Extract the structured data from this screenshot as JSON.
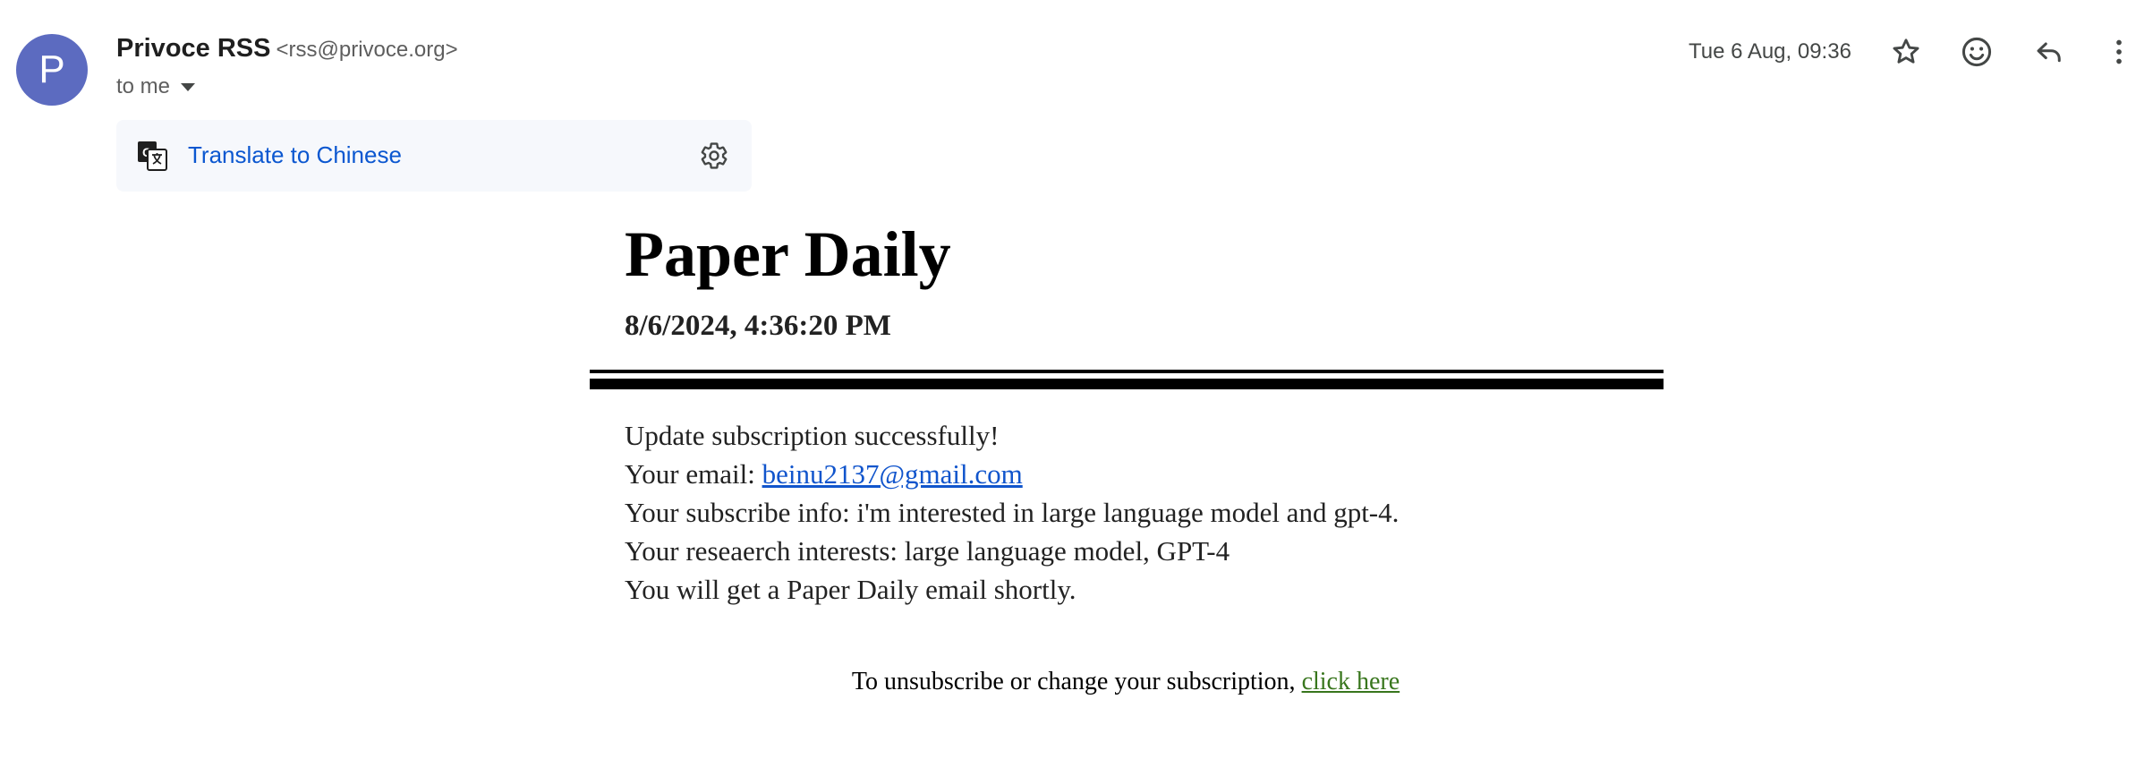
{
  "header": {
    "avatar_letter": "P",
    "avatar_color": "#5c6bc0",
    "sender_name": "Privoce RSS",
    "sender_email": "<rss@privoce.org>",
    "recipient_label": "to me",
    "date": "Tue 6 Aug, 09:36",
    "icons": [
      "star-icon",
      "emoji-icon",
      "reply-icon",
      "more-vert-icon"
    ]
  },
  "translate": {
    "label": "Translate to Chinese",
    "link_color": "#0b57d0"
  },
  "email": {
    "title": "Paper Daily",
    "timestamp": "8/6/2024, 4:36:20 PM",
    "lines": {
      "line1": "Update subscription successfully!",
      "email_prefix": "Your email: ",
      "email_value": "beinu2137@gmail.com",
      "line3": "Your subscribe info: i'm interested in large language model and gpt-4.",
      "line4": "Your reseaerch interests: large language model, GPT-4",
      "line5": "You will get a Paper Daily email shortly."
    },
    "footer_text": "To unsubscribe or change your subscription, ",
    "footer_link": "click here",
    "link_color": "#1155cc",
    "footer_link_color": "#38761d"
  }
}
